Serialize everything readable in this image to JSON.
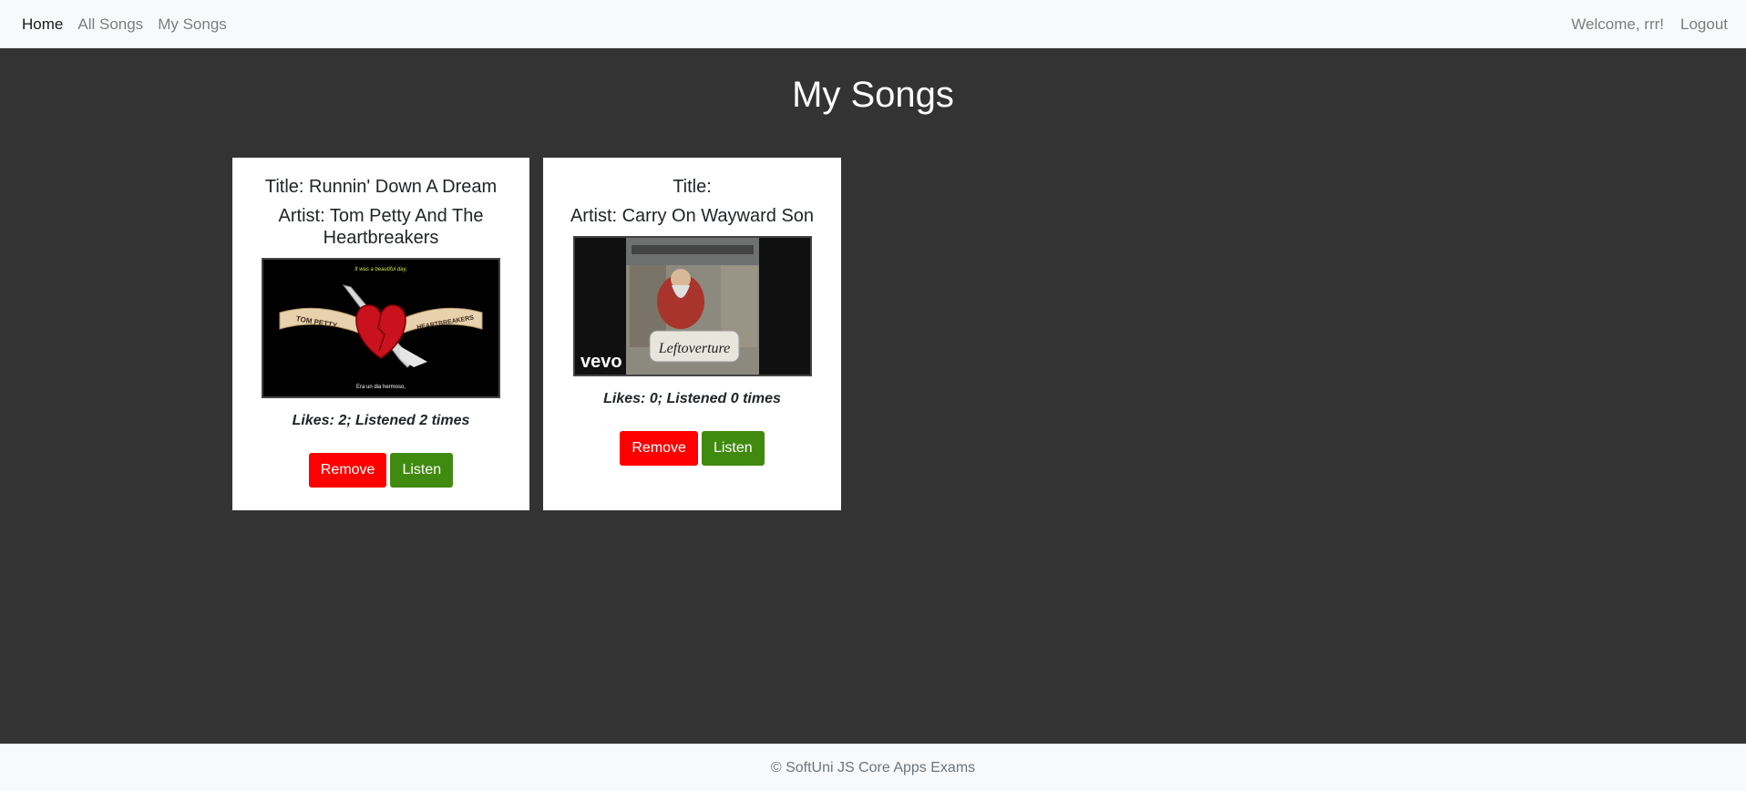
{
  "nav": {
    "home": "Home",
    "all_songs": "All Songs",
    "my_songs": "My Songs",
    "welcome": "Welcome, rrr!",
    "logout": "Logout"
  },
  "page_title": "My Songs",
  "songs": [
    {
      "title": "Title: Runnin' Down A Dream",
      "artist": "Artist: Tom Petty And The Heartbreakers",
      "thumb_text_top": "It was a beautiful day,",
      "thumb_text_bottom": "Era un dia hermoso,",
      "thumb_banner_left": "TOM PETTY",
      "thumb_banner_right": "HEARTBREAKERS",
      "likes": "Likes: 2; Listened 2 times",
      "remove_label": "Remove",
      "listen_label": "Listen"
    },
    {
      "title": "Title:",
      "artist": "Artist: Carry On Wayward Son",
      "thumb_logo": "vevo",
      "thumb_caption": "Leftoverture",
      "likes": "Likes: 0; Listened 0 times",
      "remove_label": "Remove",
      "listen_label": "Listen"
    }
  ],
  "footer": "© SoftUni JS Core Apps Exams",
  "colors": {
    "background": "#333333",
    "remove": "#ff0000",
    "listen": "#418a10"
  }
}
